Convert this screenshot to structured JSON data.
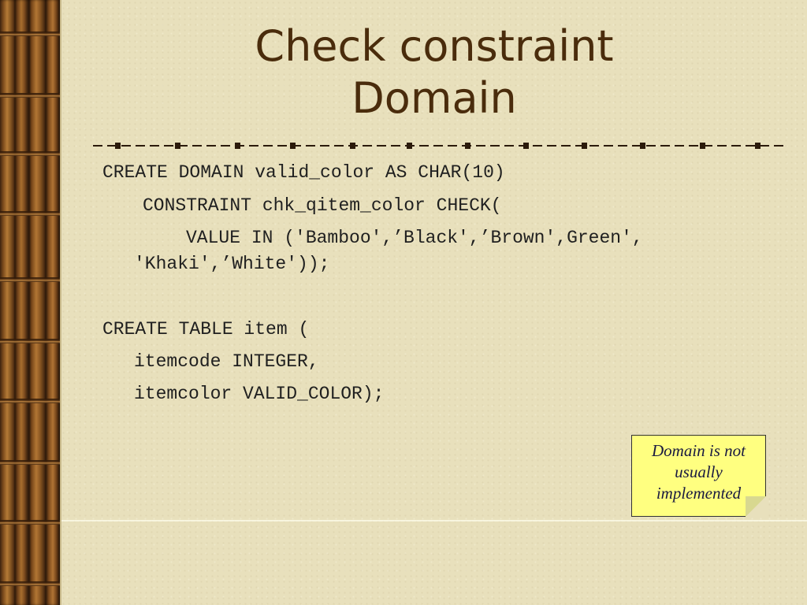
{
  "slide": {
    "title_line1": "Check constraint",
    "title_line2": "Domain",
    "code": {
      "line1": "CREATE DOMAIN valid_color AS CHAR(10)",
      "line2": "CONSTRAINT chk_qitem_color CHECK(",
      "line3": "VALUE IN ('Bamboo',’Black',’Brown',Green',",
      "line4": "'Khaki',’White'));",
      "line5": "CREATE TABLE item (",
      "line6": "itemcode INTEGER,",
      "line7": "itemcolor VALID_COLOR);"
    },
    "note": {
      "line1": "Domain is not",
      "line2": "usually",
      "line3": "implemented"
    }
  },
  "colors": {
    "title": "#4a2c0c",
    "background": "#e8e0bc",
    "note_fill": "#ffff80",
    "divider": "#2b1a0a"
  },
  "icons": {
    "left_strip": "bamboo-decoration",
    "divider": "dashed-bullet-divider"
  }
}
